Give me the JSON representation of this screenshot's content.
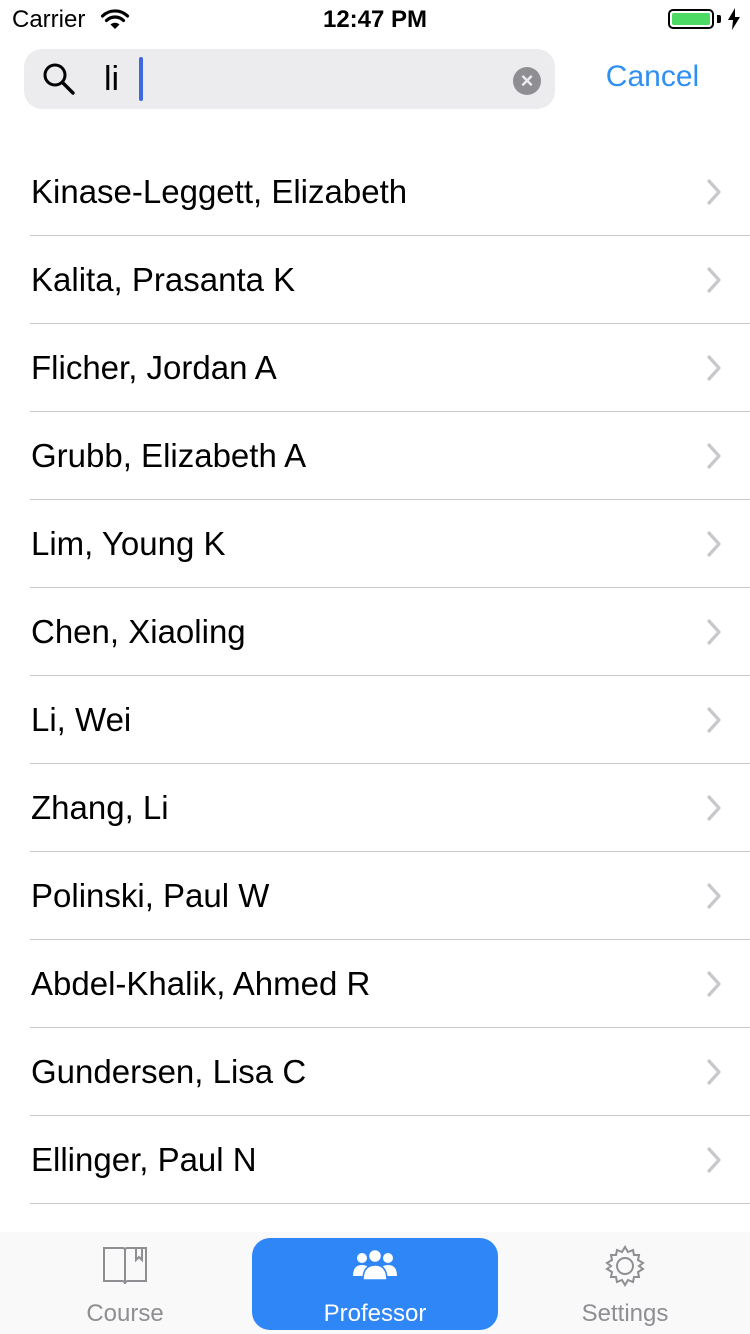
{
  "status_bar": {
    "carrier": "Carrier",
    "time": "12:47 PM",
    "battery_level": 1.0
  },
  "search": {
    "value": "li",
    "cancel_label": "Cancel"
  },
  "professors": [
    "Kinase-Leggett, Elizabeth",
    "Kalita, Prasanta K",
    "Flicher, Jordan A",
    "Grubb, Elizabeth A",
    "Lim, Young K",
    "Chen, Xiaoling",
    "Li, Wei",
    "Zhang, Li",
    "Polinski, Paul W",
    "Abdel-Khalik, Ahmed R",
    "Gundersen, Lisa C",
    "Ellinger, Paul N"
  ],
  "tab_bar": {
    "tabs": [
      {
        "label": "Course",
        "icon": "book-icon",
        "selected": false
      },
      {
        "label": "Professor",
        "icon": "people-icon",
        "selected": true
      },
      {
        "label": "Settings",
        "icon": "gear-icon",
        "selected": false
      }
    ]
  },
  "colors": {
    "accent": "#2f86f6",
    "cancel": "#2f8ff3",
    "battery": "#4cd964",
    "caret": "#3f68e0"
  }
}
